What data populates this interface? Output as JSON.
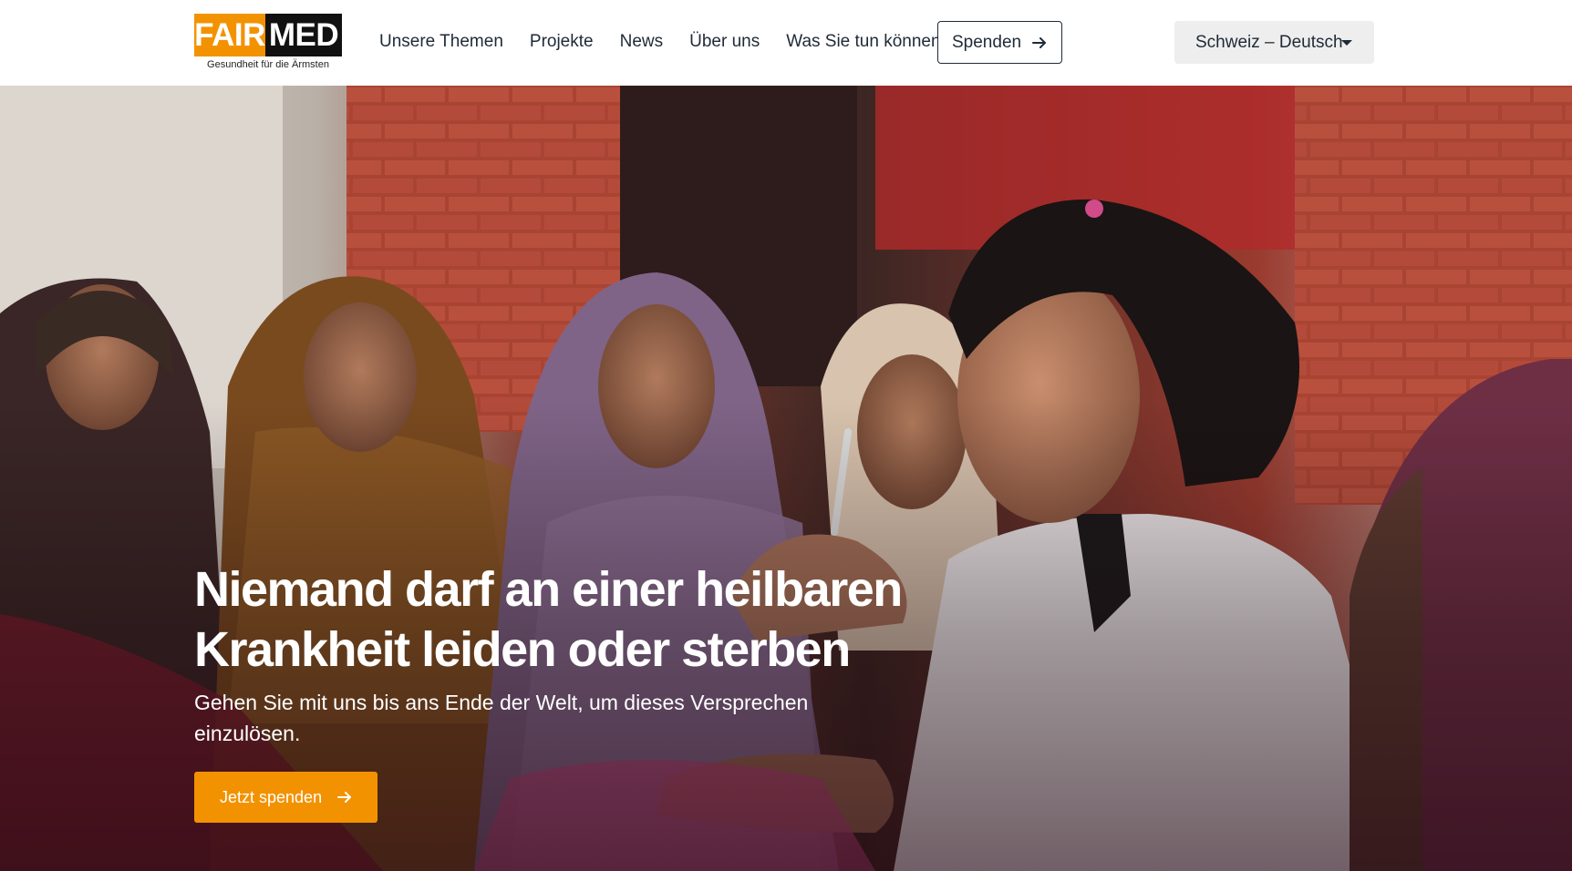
{
  "brand": {
    "logo_left": "FAIR",
    "logo_right": "MED",
    "tagline": "Gesundheit für die Ärmsten",
    "accent_color": "#f39200"
  },
  "nav": {
    "items": [
      {
        "label": "Unsere Themen"
      },
      {
        "label": "Projekte"
      },
      {
        "label": "News"
      },
      {
        "label": "Über uns"
      },
      {
        "label": "Was Sie tun können"
      }
    ],
    "donate_label": "Spenden",
    "donate_icon": "arrow-right-icon",
    "language_label": "Schweiz – Deutsch",
    "language_icon": "caret-down-icon"
  },
  "hero": {
    "title_line1": "Niemand darf an einer heilbaren",
    "title_line2": "Krankheit leiden oder sterben",
    "subtitle": "Gehen Sie mit uns bis ans Ende der Welt, um dieses Versprechen einzulösen.",
    "cta_label": "Jetzt spenden",
    "cta_icon": "arrow-right-icon"
  }
}
